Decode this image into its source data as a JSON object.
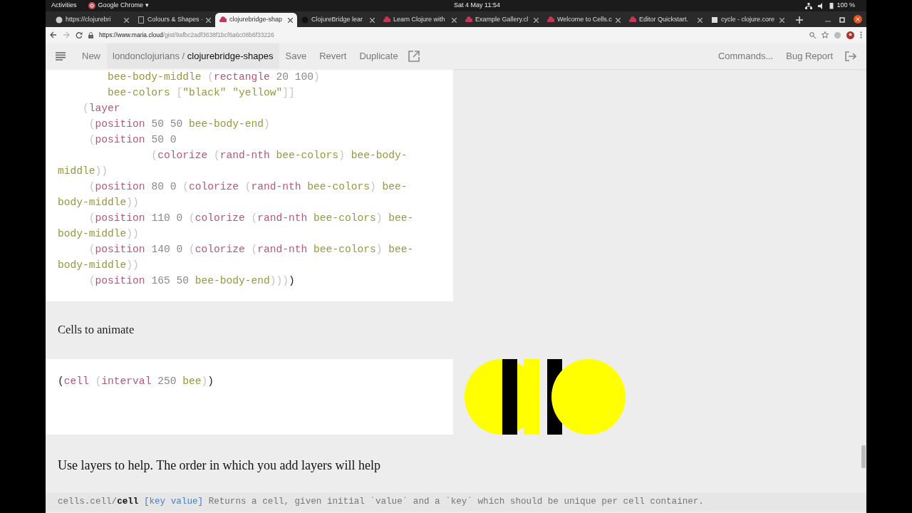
{
  "system_bar": {
    "activities": "Activities",
    "app_menu": "Google Chrome ▾",
    "clock": "Sat 4 May  11:54",
    "battery": "100 %"
  },
  "tabs": [
    {
      "title": "https://clojurebri",
      "selected": false
    },
    {
      "title": "Colours & Shapes ·",
      "selected": false
    },
    {
      "title": "clojurebridge-shap",
      "selected": true
    },
    {
      "title": "ClojureBridge lear",
      "selected": false
    },
    {
      "title": "Learn Clojure with",
      "selected": false
    },
    {
      "title": "Example Gallery.cl",
      "selected": false
    },
    {
      "title": "Welcome to Cells.c",
      "selected": false
    },
    {
      "title": "Editor Quickstart.",
      "selected": false
    },
    {
      "title": "cycle - clojure.core",
      "selected": false
    }
  ],
  "address": {
    "host": "https://www.maria.cloud",
    "path": "/gist/9afbc2adf3638f1bcf6a6c08b6f33226"
  },
  "toolbar": {
    "new": "New",
    "owner": "londonclojurians / ",
    "doc_name": "clojurebridge-shapes",
    "actions": [
      "Save",
      "Revert",
      "Duplicate"
    ],
    "right": [
      "Commands...",
      "Bug Report"
    ]
  },
  "code_blocks": [
    {
      "lines": [
        [
          {
            "kind": "sym",
            "text": "        bee-body-middle "
          },
          {
            "kind": "paren",
            "text": "("
          },
          {
            "kind": "fn",
            "text": "rectangle "
          },
          {
            "kind": "num",
            "text": "20 100"
          },
          {
            "kind": "paren",
            "text": ")"
          }
        ],
        [
          {
            "kind": "sym",
            "text": "        bee-colors "
          },
          {
            "kind": "paren",
            "text": "["
          },
          {
            "kind": "str",
            "text": "\"black\" \"yellow\""
          },
          {
            "kind": "paren",
            "text": "]]"
          }
        ],
        [
          {
            "kind": "paren",
            "text": "    ("
          },
          {
            "kind": "fn",
            "text": "layer"
          }
        ],
        [
          {
            "kind": "paren",
            "text": "     ("
          },
          {
            "kind": "fn",
            "text": "position "
          },
          {
            "kind": "num",
            "text": "50 50 "
          },
          {
            "kind": "sym",
            "text": "bee-body-end"
          },
          {
            "kind": "paren",
            "text": ")"
          }
        ],
        [
          {
            "kind": "paren",
            "text": "     ("
          },
          {
            "kind": "fn",
            "text": "position "
          },
          {
            "kind": "num",
            "text": "50 0"
          }
        ],
        [
          {
            "kind": "paren",
            "text": "               ("
          },
          {
            "kind": "fn",
            "text": "colorize "
          },
          {
            "kind": "paren",
            "text": "("
          },
          {
            "kind": "fn",
            "text": "rand-nth "
          },
          {
            "kind": "sym",
            "text": "bee-colors"
          },
          {
            "kind": "paren",
            "text": ") "
          },
          {
            "kind": "sym",
            "text": "bee-body-"
          }
        ],
        [
          {
            "kind": "sym",
            "text": "middle"
          },
          {
            "kind": "paren",
            "text": "))"
          }
        ],
        [
          {
            "kind": "paren",
            "text": "     ("
          },
          {
            "kind": "fn",
            "text": "position "
          },
          {
            "kind": "num",
            "text": "80 0 "
          },
          {
            "kind": "paren",
            "text": "("
          },
          {
            "kind": "fn",
            "text": "colorize "
          },
          {
            "kind": "paren",
            "text": "("
          },
          {
            "kind": "fn",
            "text": "rand-nth "
          },
          {
            "kind": "sym",
            "text": "bee-colors"
          },
          {
            "kind": "paren",
            "text": ") "
          },
          {
            "kind": "sym",
            "text": "bee-"
          }
        ],
        [
          {
            "kind": "sym",
            "text": "body-middle"
          },
          {
            "kind": "paren",
            "text": "))"
          }
        ],
        [
          {
            "kind": "paren",
            "text": "     ("
          },
          {
            "kind": "fn",
            "text": "position "
          },
          {
            "kind": "num",
            "text": "110 0 "
          },
          {
            "kind": "paren",
            "text": "("
          },
          {
            "kind": "fn",
            "text": "colorize "
          },
          {
            "kind": "paren",
            "text": "("
          },
          {
            "kind": "fn",
            "text": "rand-nth "
          },
          {
            "kind": "sym",
            "text": "bee-colors"
          },
          {
            "kind": "paren",
            "text": ") "
          },
          {
            "kind": "sym",
            "text": "bee-"
          }
        ],
        [
          {
            "kind": "sym",
            "text": "body-middle"
          },
          {
            "kind": "paren",
            "text": "))"
          }
        ],
        [
          {
            "kind": "paren",
            "text": "     ("
          },
          {
            "kind": "fn",
            "text": "position "
          },
          {
            "kind": "num",
            "text": "140 0 "
          },
          {
            "kind": "paren",
            "text": "("
          },
          {
            "kind": "fn",
            "text": "colorize "
          },
          {
            "kind": "paren",
            "text": "("
          },
          {
            "kind": "fn",
            "text": "rand-nth "
          },
          {
            "kind": "sym",
            "text": "bee-colors"
          },
          {
            "kind": "paren",
            "text": ") "
          },
          {
            "kind": "sym",
            "text": "bee-"
          }
        ],
        [
          {
            "kind": "sym",
            "text": "body-middle"
          },
          {
            "kind": "paren",
            "text": "))"
          }
        ],
        [
          {
            "kind": "paren",
            "text": "     ("
          },
          {
            "kind": "fn",
            "text": "position "
          },
          {
            "kind": "num",
            "text": "165 50 "
          },
          {
            "kind": "sym",
            "text": "bee-body-end"
          },
          {
            "kind": "paren",
            "text": ")))"
          },
          {
            "kind": "plain",
            "text": ")"
          }
        ]
      ]
    },
    {
      "heading": "Cells to animate"
    },
    {
      "lines": [
        [
          {
            "kind": "plain",
            "text": "("
          },
          {
            "kind": "fn",
            "text": "cell "
          },
          {
            "kind": "paren",
            "text": "("
          },
          {
            "kind": "fn",
            "text": "interval "
          },
          {
            "kind": "num",
            "text": "250 "
          },
          {
            "kind": "sym",
            "text": "bee"
          },
          {
            "kind": "paren",
            "text": ")"
          },
          {
            "kind": "plain",
            "text": ")"
          }
        ]
      ]
    },
    {
      "paragraph": "Use layers to help.  The order in which you add layers will help"
    }
  ],
  "doc_bar": {
    "namespace": "cells.cell/",
    "name": "cell",
    "args": "[key value]",
    "text": "Returns a cell, given initial `value` and a `key` which should be unique per cell container."
  }
}
